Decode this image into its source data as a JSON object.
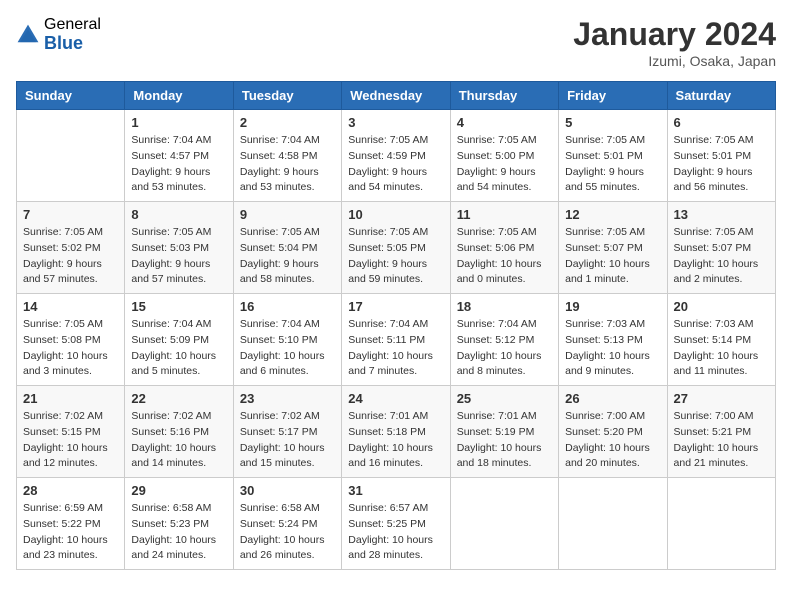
{
  "header": {
    "logo_general": "General",
    "logo_blue": "Blue",
    "month_title": "January 2024",
    "location": "Izumi, Osaka, Japan"
  },
  "days_of_week": [
    "Sunday",
    "Monday",
    "Tuesday",
    "Wednesday",
    "Thursday",
    "Friday",
    "Saturday"
  ],
  "weeks": [
    [
      {
        "day": "",
        "info": ""
      },
      {
        "day": "1",
        "info": "Sunrise: 7:04 AM\nSunset: 4:57 PM\nDaylight: 9 hours\nand 53 minutes."
      },
      {
        "day": "2",
        "info": "Sunrise: 7:04 AM\nSunset: 4:58 PM\nDaylight: 9 hours\nand 53 minutes."
      },
      {
        "day": "3",
        "info": "Sunrise: 7:05 AM\nSunset: 4:59 PM\nDaylight: 9 hours\nand 54 minutes."
      },
      {
        "day": "4",
        "info": "Sunrise: 7:05 AM\nSunset: 5:00 PM\nDaylight: 9 hours\nand 54 minutes."
      },
      {
        "day": "5",
        "info": "Sunrise: 7:05 AM\nSunset: 5:01 PM\nDaylight: 9 hours\nand 55 minutes."
      },
      {
        "day": "6",
        "info": "Sunrise: 7:05 AM\nSunset: 5:01 PM\nDaylight: 9 hours\nand 56 minutes."
      }
    ],
    [
      {
        "day": "7",
        "info": "Sunrise: 7:05 AM\nSunset: 5:02 PM\nDaylight: 9 hours\nand 57 minutes."
      },
      {
        "day": "8",
        "info": "Sunrise: 7:05 AM\nSunset: 5:03 PM\nDaylight: 9 hours\nand 57 minutes."
      },
      {
        "day": "9",
        "info": "Sunrise: 7:05 AM\nSunset: 5:04 PM\nDaylight: 9 hours\nand 58 minutes."
      },
      {
        "day": "10",
        "info": "Sunrise: 7:05 AM\nSunset: 5:05 PM\nDaylight: 9 hours\nand 59 minutes."
      },
      {
        "day": "11",
        "info": "Sunrise: 7:05 AM\nSunset: 5:06 PM\nDaylight: 10 hours\nand 0 minutes."
      },
      {
        "day": "12",
        "info": "Sunrise: 7:05 AM\nSunset: 5:07 PM\nDaylight: 10 hours\nand 1 minute."
      },
      {
        "day": "13",
        "info": "Sunrise: 7:05 AM\nSunset: 5:07 PM\nDaylight: 10 hours\nand 2 minutes."
      }
    ],
    [
      {
        "day": "14",
        "info": "Sunrise: 7:05 AM\nSunset: 5:08 PM\nDaylight: 10 hours\nand 3 minutes."
      },
      {
        "day": "15",
        "info": "Sunrise: 7:04 AM\nSunset: 5:09 PM\nDaylight: 10 hours\nand 5 minutes."
      },
      {
        "day": "16",
        "info": "Sunrise: 7:04 AM\nSunset: 5:10 PM\nDaylight: 10 hours\nand 6 minutes."
      },
      {
        "day": "17",
        "info": "Sunrise: 7:04 AM\nSunset: 5:11 PM\nDaylight: 10 hours\nand 7 minutes."
      },
      {
        "day": "18",
        "info": "Sunrise: 7:04 AM\nSunset: 5:12 PM\nDaylight: 10 hours\nand 8 minutes."
      },
      {
        "day": "19",
        "info": "Sunrise: 7:03 AM\nSunset: 5:13 PM\nDaylight: 10 hours\nand 9 minutes."
      },
      {
        "day": "20",
        "info": "Sunrise: 7:03 AM\nSunset: 5:14 PM\nDaylight: 10 hours\nand 11 minutes."
      }
    ],
    [
      {
        "day": "21",
        "info": "Sunrise: 7:02 AM\nSunset: 5:15 PM\nDaylight: 10 hours\nand 12 minutes."
      },
      {
        "day": "22",
        "info": "Sunrise: 7:02 AM\nSunset: 5:16 PM\nDaylight: 10 hours\nand 14 minutes."
      },
      {
        "day": "23",
        "info": "Sunrise: 7:02 AM\nSunset: 5:17 PM\nDaylight: 10 hours\nand 15 minutes."
      },
      {
        "day": "24",
        "info": "Sunrise: 7:01 AM\nSunset: 5:18 PM\nDaylight: 10 hours\nand 16 minutes."
      },
      {
        "day": "25",
        "info": "Sunrise: 7:01 AM\nSunset: 5:19 PM\nDaylight: 10 hours\nand 18 minutes."
      },
      {
        "day": "26",
        "info": "Sunrise: 7:00 AM\nSunset: 5:20 PM\nDaylight: 10 hours\nand 20 minutes."
      },
      {
        "day": "27",
        "info": "Sunrise: 7:00 AM\nSunset: 5:21 PM\nDaylight: 10 hours\nand 21 minutes."
      }
    ],
    [
      {
        "day": "28",
        "info": "Sunrise: 6:59 AM\nSunset: 5:22 PM\nDaylight: 10 hours\nand 23 minutes."
      },
      {
        "day": "29",
        "info": "Sunrise: 6:58 AM\nSunset: 5:23 PM\nDaylight: 10 hours\nand 24 minutes."
      },
      {
        "day": "30",
        "info": "Sunrise: 6:58 AM\nSunset: 5:24 PM\nDaylight: 10 hours\nand 26 minutes."
      },
      {
        "day": "31",
        "info": "Sunrise: 6:57 AM\nSunset: 5:25 PM\nDaylight: 10 hours\nand 28 minutes."
      },
      {
        "day": "",
        "info": ""
      },
      {
        "day": "",
        "info": ""
      },
      {
        "day": "",
        "info": ""
      }
    ]
  ]
}
